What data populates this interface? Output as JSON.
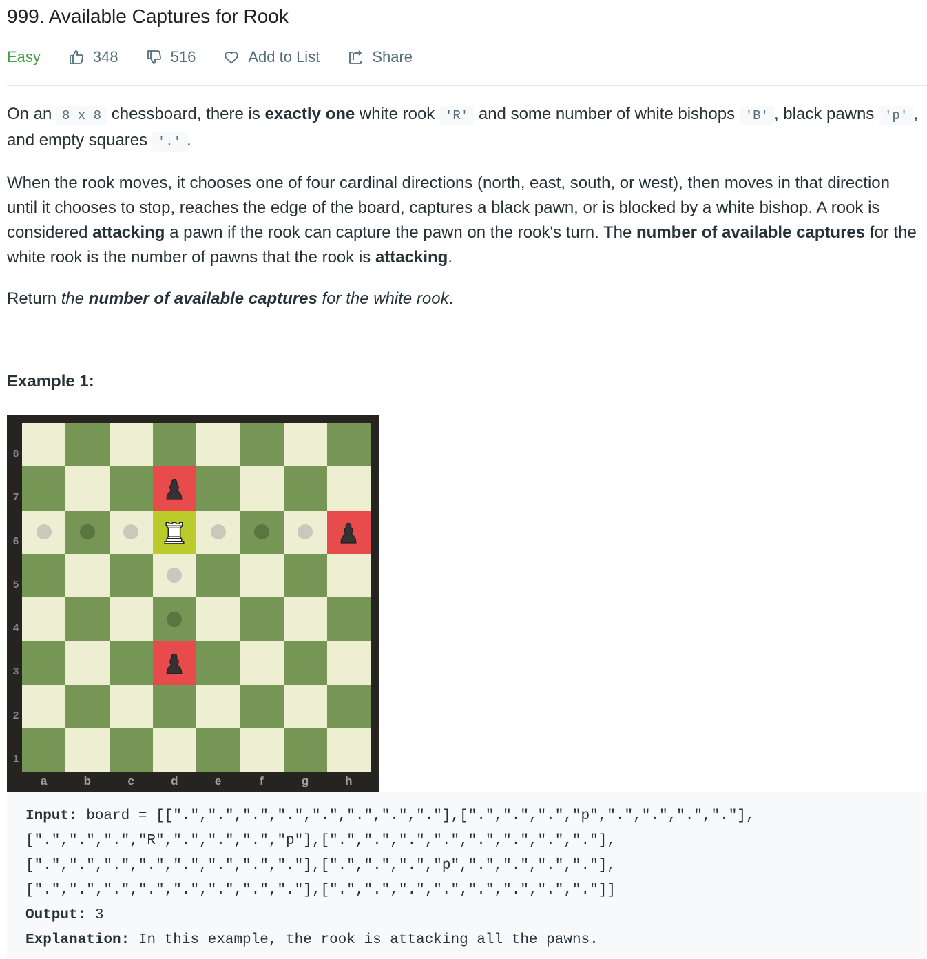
{
  "problem": {
    "title": "999. Available Captures for Rook",
    "difficulty": "Easy",
    "likes": "348",
    "dislikes": "516",
    "add_to_list": "Add to List",
    "share": "Share"
  },
  "description": {
    "p1": {
      "t1": "On an ",
      "c1": "8 x 8",
      "t2": " chessboard, there is ",
      "b1": "exactly one",
      "t3": " white rook ",
      "c2": "'R'",
      "t4": " and some number of white bishops ",
      "c3": "'B'",
      "t5": ", black pawns ",
      "c4": "'p'",
      "t6": ", and empty squares ",
      "c5": "'.'",
      "t7": "."
    },
    "p2": {
      "t1": "When the rook moves, it chooses one of four cardinal directions (north, east, south, or west), then moves in that direction until it chooses to stop, reaches the edge of the board, captures a black pawn, or is blocked by a white bishop. A rook is considered ",
      "b1": "attacking",
      "t2": " a pawn if the rook can capture the pawn on the rook's turn. The ",
      "b2": "number of available captures",
      "t3": " for the white rook is the number of pawns that the rook is ",
      "b3": "attacking",
      "t4": "."
    },
    "p3": {
      "t1": "Return ",
      "i1": "the ",
      "bi1": "number of available captures",
      "i2": " for the white rook",
      "t2": "."
    }
  },
  "example": {
    "title": "Example 1:",
    "board": [
      [
        ".",
        ".",
        ".",
        ".",
        ".",
        ".",
        ".",
        "."
      ],
      [
        ".",
        ".",
        ".",
        "p",
        ".",
        ".",
        ".",
        "."
      ],
      [
        ".",
        ".",
        ".",
        "R",
        ".",
        ".",
        ".",
        "p"
      ],
      [
        ".",
        ".",
        ".",
        ".",
        ".",
        ".",
        ".",
        "."
      ],
      [
        ".",
        ".",
        ".",
        ".",
        ".",
        ".",
        ".",
        "."
      ],
      [
        ".",
        ".",
        ".",
        "p",
        ".",
        ".",
        ".",
        "."
      ],
      [
        ".",
        ".",
        ".",
        ".",
        ".",
        ".",
        ".",
        "."
      ],
      [
        ".",
        ".",
        ".",
        ".",
        ".",
        ".",
        ".",
        "."
      ]
    ],
    "move_dots": [
      "a6",
      "b6",
      "c6",
      "e6",
      "f6",
      "g6",
      "d5",
      "d4"
    ],
    "highlight_red": [
      "d7",
      "h6",
      "d3"
    ],
    "highlight_yellow": [
      "d6"
    ],
    "ranks": [
      "8",
      "7",
      "6",
      "5",
      "4",
      "3",
      "2",
      "1"
    ],
    "files": [
      "a",
      "b",
      "c",
      "d",
      "e",
      "f",
      "g",
      "h"
    ],
    "input_label": "Input:",
    "input_lines": [
      " board = [[\".\",\".\",\".\",\".\",\".\",\".\",\".\",\".\"],[\".\",\".\",\".\",\"p\",\".\",\".\",\".\",\".\"],",
      "[\".\",\".\",\".\",\"R\",\".\",\".\",\".\",\"p\"],[\".\",\".\",\".\",\".\",\".\",\".\",\".\",\".\"],",
      "[\".\",\".\",\".\",\".\",\".\",\".\",\".\",\".\"],[\".\",\".\",\".\",\"p\",\".\",\".\",\".\",\".\"],",
      "[\".\",\".\",\".\",\".\",\".\",\".\",\".\",\".\"],[\".\",\".\",\".\",\".\",\".\",\".\",\".\",\".\"]]"
    ],
    "output_label": "Output:",
    "output_value": " 3",
    "explanation_label": "Explanation:",
    "explanation_value": " In this example, the rook is attacking all the pawns."
  },
  "colors": {
    "easy": "#43a047",
    "board_light": "#eeeed2",
    "board_dark": "#769656",
    "highlight_red": "#e84b4b",
    "highlight_yellow": "#bbcb2b"
  },
  "icons": {
    "like": "thumbs-up-icon",
    "dislike": "thumbs-down-icon",
    "add_to_list": "heart-icon",
    "share": "share-icon",
    "pawn": "black-pawn-icon",
    "rook": "white-rook-icon"
  }
}
